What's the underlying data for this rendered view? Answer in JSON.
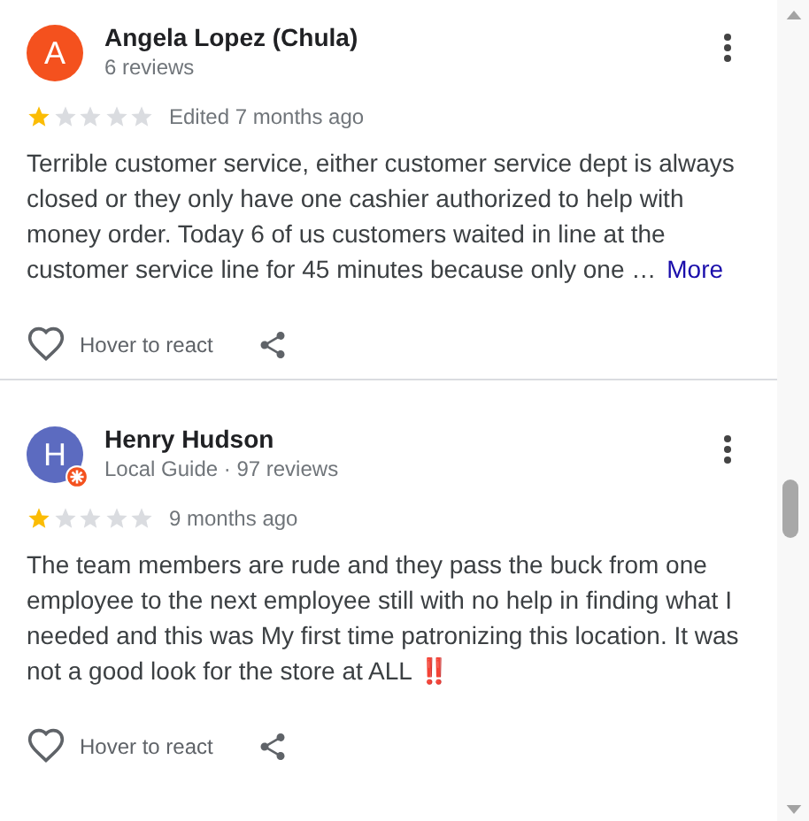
{
  "reviews": [
    {
      "avatar_letter": "A",
      "color": "#f4511e",
      "local_guide": false,
      "name": "Angela Lopez (Chula)",
      "meta": "6 reviews",
      "stars": 1,
      "time": "Edited 7 months ago",
      "text": "Terrible customer service, either customer service dept is always closed or they only have one cashier authorized to help with money order. Today 6 of us customers waited in line at the customer service line for 45 minutes because only one …",
      "more": "More",
      "react": "Hover to react"
    },
    {
      "avatar_letter": "H",
      "color": "#5c6bc0",
      "local_guide": true,
      "name": "Henry Hudson",
      "meta": "Local Guide · 97 reviews",
      "stars": 1,
      "time": "9 months ago",
      "text": "The team members are rude and they pass the buck from one employee to the next employee still with no help in finding what I needed and this was My first time patronizing this location. It was not a good look for the store at ALL ‼️",
      "react": "Hover to react"
    }
  ]
}
